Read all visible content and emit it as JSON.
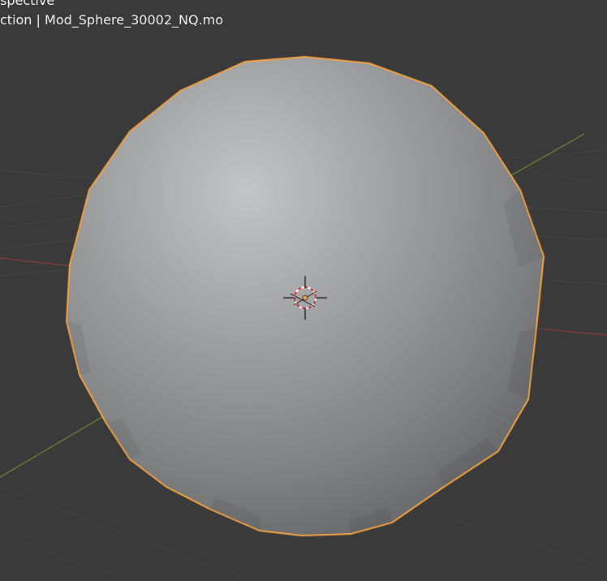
{
  "viewport": {
    "view_name": "spective",
    "info_line": "ction | Mod_Sphere_30002_NQ.mo"
  },
  "colors": {
    "background": "#3a3a3a",
    "grid": "#444444",
    "x_axis": "#8a3a3a",
    "y_axis": "#6d8a3a",
    "selection_outline": "#f0a040",
    "object_origin": "#f0a040"
  },
  "icons": [
    "3d-cursor-icon",
    "object-origin-icon"
  ]
}
